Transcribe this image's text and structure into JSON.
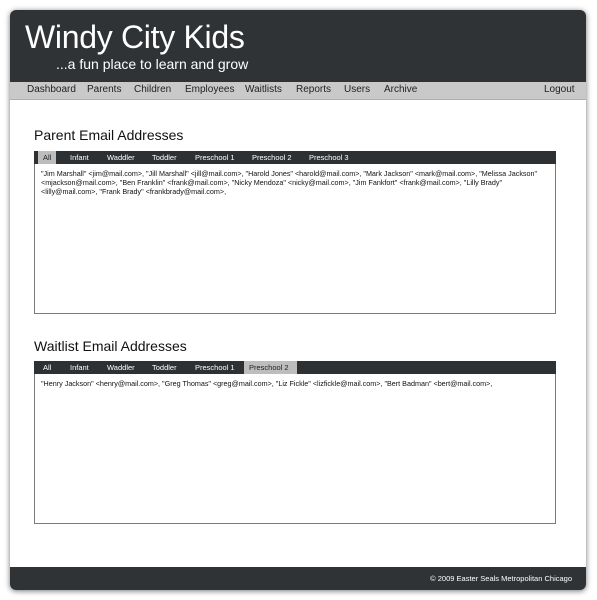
{
  "header": {
    "title": "Windy City Kids",
    "tagline": "...a fun place to learn and grow"
  },
  "nav": {
    "items": [
      "Dashboard",
      "Parents",
      "Children",
      "Employees",
      "Waitlists",
      "Reports",
      "Users",
      "Archive"
    ],
    "logout": "Logout"
  },
  "parent_section": {
    "title": "Parent Email Addresses",
    "tabs": [
      "All",
      "Infant",
      "Waddler",
      "Toddler",
      "Preschool 1",
      "Preschool 2",
      "Preschool 3"
    ],
    "active_tab": "All",
    "emails": "\"Jim Marshall\" <jim@mail.com>, \"Jill Marshall\" <jill@mail.com>, \"Harold Jones\" <harold@mail.com>, \"Mark Jackson\" <mark@mail.com>, \"Melissa Jackson\" <mjackson@mail.com>, \"Ben Franklin\" <frank@mail.com>, \"Nicky Mendoza\" <nicky@mail.com>, \"Jim Fankfort\" <frank@mail.com>, \"Lilly Brady\" <lilly@mail.com>, \"Frank Brady\" <frankbrady@mail.com>,"
  },
  "waitlist_section": {
    "title": "Waitlist Email Addresses",
    "tabs": [
      "All",
      "Infant",
      "Waddler",
      "Toddler",
      "Preschool 1",
      "Preschool 2"
    ],
    "active_tab": "Preschool 2",
    "emails": "\"Henry Jackson\" <henry@mail.com>, \"Greg Thomas\" <greg@mail.com>, \"Liz Fickle\" <lizfickle@mail.com>, \"Bert Badman\" <bert@mail.com>,"
  },
  "footer": {
    "copyright": "© 2009 Easter Seals Metropolitan Chicago"
  },
  "colors": {
    "header_bg": "#303336",
    "nav_bg": "#c9c9c9",
    "tabbar_bg": "#2e3134",
    "active_tab_bg": "#bdbdbd"
  }
}
